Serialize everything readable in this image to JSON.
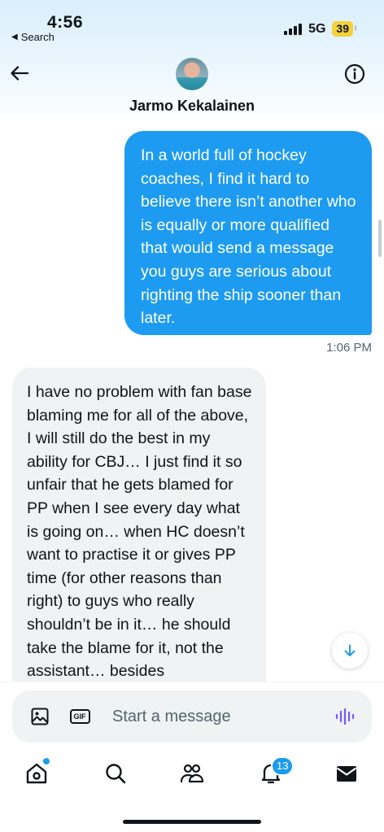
{
  "status_bar": {
    "time": "4:56",
    "back_label": "Search",
    "network": "5G",
    "battery": "39"
  },
  "header": {
    "contact_name": "Jarmo Kekalainen"
  },
  "messages": [
    {
      "direction": "outgoing",
      "text": "In a world full of hockey coaches, I find it hard to believe there isn’t another who is equally or more qualified that would send a message you guys are serious about righting the ship sooner than later.",
      "time": "1:06 PM"
    },
    {
      "direction": "incoming",
      "text": "I have no problem with fan base blaming me for all of the above, I will still do the best in my ability for CBJ… I just find it so unfair that he gets blamed for PP when I see every day what is going on… when HC doesn’t want to practise it or gives PP time (for other reasons than right) to guys who really shouldn’t be in it… he should take the blame for it, not the assistant… besides"
    }
  ],
  "composer": {
    "gif_label": "GIF",
    "placeholder": "Start a message"
  },
  "bottom_nav": {
    "items": [
      "home-icon",
      "search-icon",
      "communities-icon",
      "notifications-icon",
      "messages-icon"
    ],
    "notifications_count": "13"
  },
  "colors": {
    "accent": "#1d9bf0",
    "incoming_bubble": "#eff3f4",
    "text": "#0f1419",
    "muted": "#536471"
  }
}
